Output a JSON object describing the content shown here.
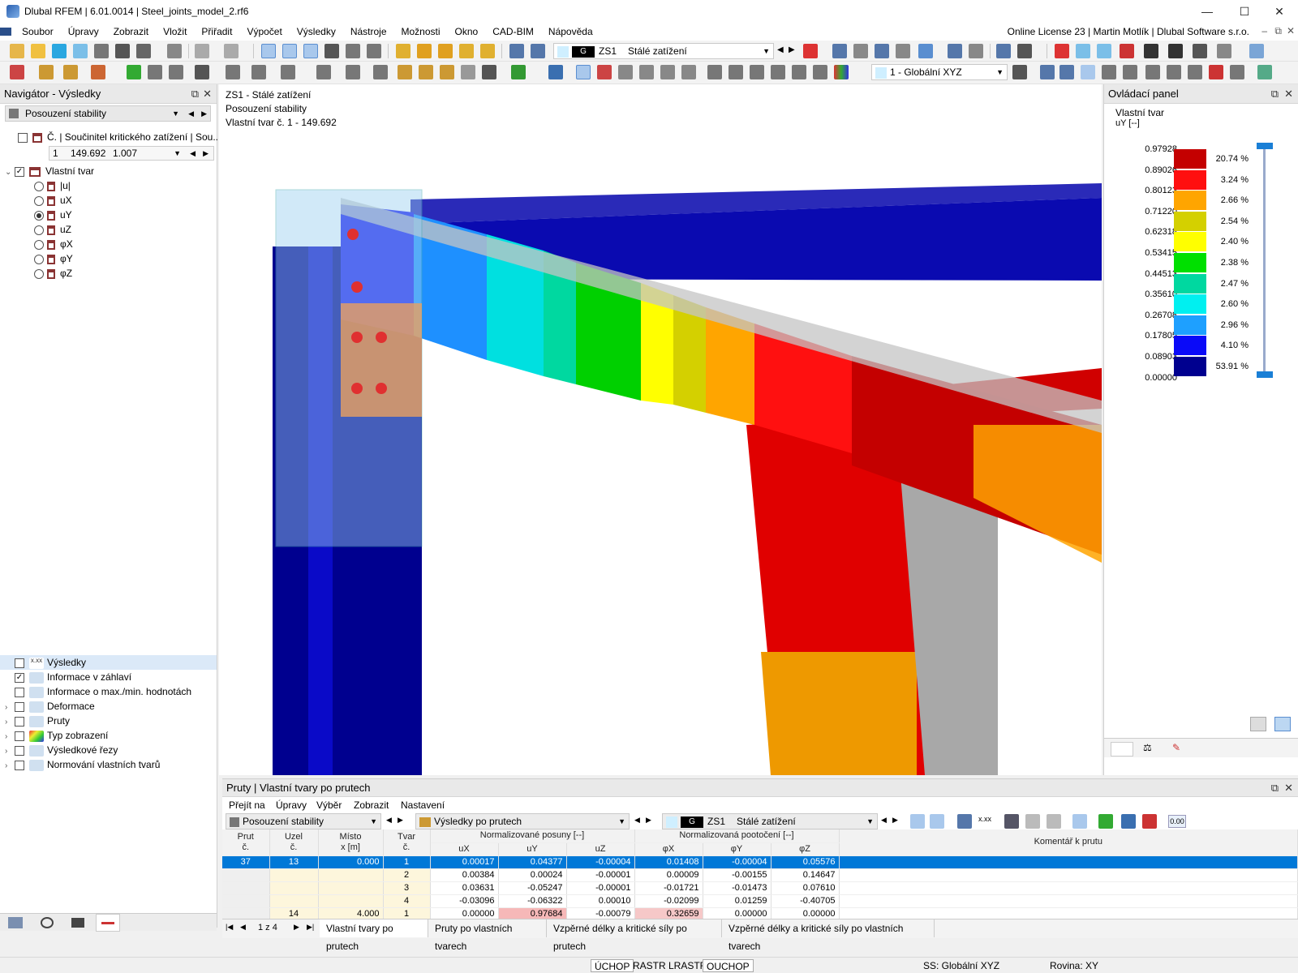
{
  "window": {
    "title": "Dlubal RFEM | 6.01.0014 | Steel_joints_model_2.rf6"
  },
  "menu": {
    "items": [
      "Soubor",
      "Úpravy",
      "Zobrazit",
      "Vložit",
      "Přiřadit",
      "Výpočet",
      "Výsledky",
      "Nástroje",
      "Možnosti",
      "Okno",
      "CAD-BIM",
      "Nápověda"
    ],
    "license": "Online License 23 | Martin Motlík | Dlubal Software s.r.o."
  },
  "toolbar": {
    "lc_g": "G",
    "lc_id": "ZS1",
    "lc_name": "Stálé zatížení",
    "coord": "1 - Globální XYZ"
  },
  "navigator": {
    "title": "Navigátor - Výsledky",
    "combo": "Posouzení stability",
    "crit_header": "Č. | Součinitel kritického zatížení | Sou...",
    "crit_row": {
      "no": "1",
      "factor": "149.692",
      "sec": "1.007"
    },
    "mode_shape": "Vlastní tvar",
    "components": [
      "|u|",
      "uX",
      "uY",
      "uZ",
      "φX",
      "φY",
      "φZ"
    ],
    "bottom_items": [
      "Výsledky",
      "Informace v záhlaví",
      "Informace o max./min. hodnotách",
      "Deformace",
      "Pruty",
      "Typ zobrazení",
      "Výsledkové řezy",
      "Normování vlastních tvarů"
    ],
    "bottom_icon_tags": [
      "x.xx",
      "",
      "",
      "",
      "",
      "",
      "",
      ""
    ]
  },
  "viewport": {
    "line1": "ZS1 - Stálé zatížení",
    "line2": "Posouzení stability",
    "line3": "Vlastní tvar č. 1 - 149.692"
  },
  "control_panel": {
    "title": "Ovládací panel",
    "subtitle": "Vlastní tvar",
    "unit": "uY [--]",
    "values": [
      "0.97928",
      "0.89026",
      "0.80123",
      "0.71220",
      "0.62318",
      "0.53415",
      "0.44513",
      "0.35610",
      "0.26708",
      "0.17805",
      "0.08903",
      "0.00000"
    ],
    "colors": [
      "#c40000",
      "#ff0f0f",
      "#ffa500",
      "#d4d000",
      "#ffff00",
      "#00e000",
      "#00d8a0",
      "#00f0f0",
      "#1ea0ff",
      "#0a0af8",
      "#00008f"
    ],
    "percents": [
      "20.74 %",
      "3.24 %",
      "2.66 %",
      "2.54 %",
      "2.40 %",
      "2.38 %",
      "2.47 %",
      "2.60 %",
      "2.96 %",
      "4.10 %",
      "53.91 %"
    ]
  },
  "bottom_panel": {
    "title": "Pruty | Vlastní tvary po prutech",
    "menu": [
      "Přejít na",
      "Úpravy",
      "Výběr",
      "Zobrazit",
      "Nastavení"
    ],
    "combo1": "Posouzení stability",
    "combo2": "Výsledky po prutech",
    "lc_g": "G",
    "lc_id": "ZS1",
    "lc_name": "Stálé zatížení",
    "toolbar_tag_1": "x.xx",
    "toolbar_tag_2": "0.00",
    "hdr": {
      "prut": "Prut",
      "prut_no": "č.",
      "uzel": "Uzel",
      "uzel_no": "č.",
      "misto": "Místo",
      "misto_unit": "x [m]",
      "tvar": "Tvar",
      "tvar_no": "č.",
      "group1": "Normalizované posuny [--]",
      "group2": "Normalizovaná pootočení [--]",
      "ux": "uX",
      "uy": "uY",
      "uz": "uZ",
      "px": "φX",
      "py": "φY",
      "pz": "φZ",
      "comment": "Komentář k prutu"
    },
    "rows": [
      {
        "prut": "37",
        "uzel": "13",
        "x": "0.000",
        "tvar": "1",
        "ux": "0.00017",
        "uy": "0.04377",
        "uz": "-0.00004",
        "px": "0.01408",
        "py": "-0.00004",
        "pz": "0.05576"
      },
      {
        "prut": "",
        "uzel": "",
        "x": "",
        "tvar": "2",
        "ux": "0.00384",
        "uy": "0.00024",
        "uz": "-0.00001",
        "px": "0.00009",
        "py": "-0.00155",
        "pz": "0.14647"
      },
      {
        "prut": "",
        "uzel": "",
        "x": "",
        "tvar": "3",
        "ux": "0.03631",
        "uy": "-0.05247",
        "uz": "-0.00001",
        "px": "-0.01721",
        "py": "-0.01473",
        "pz": "0.07610"
      },
      {
        "prut": "",
        "uzel": "",
        "x": "",
        "tvar": "4",
        "ux": "-0.03096",
        "uy": "-0.06322",
        "uz": "0.00010",
        "px": "-0.02099",
        "py": "0.01259",
        "pz": "-0.40705"
      },
      {
        "prut": "",
        "uzel": "14",
        "x": "4.000",
        "tvar": "1",
        "ux": "0.00000",
        "uy": "0.97684",
        "uz": "-0.00079",
        "px": "0.32659",
        "py": "0.00000",
        "pz": "0.00000"
      }
    ],
    "pager": "1 z 4",
    "tabs": [
      "Vlastní tvary po prutech",
      "Pruty po vlastních tvarech",
      "Vzpěrné délky a kritické síly po prutech",
      "Vzpěrné délky a kritické síly po vlastních tvarech"
    ]
  },
  "status": {
    "items": [
      "ÚCHOP",
      "RASTR",
      "LRASTR",
      "OUCHOP"
    ],
    "ss": "SS: Globální XYZ",
    "plane": "Rovina: XY"
  }
}
